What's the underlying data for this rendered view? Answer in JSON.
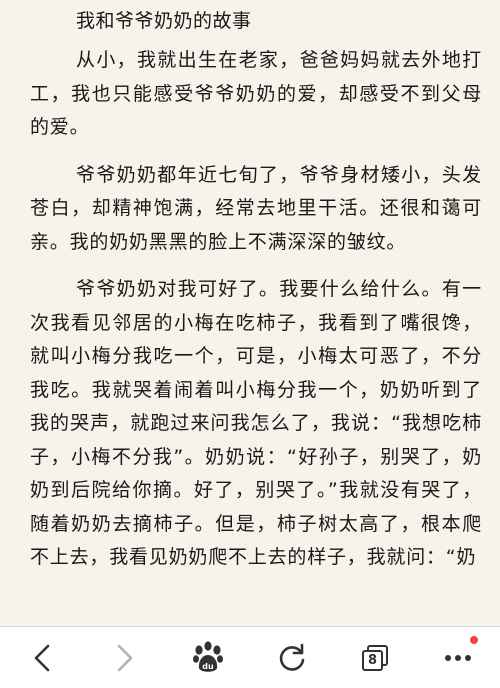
{
  "article": {
    "title": "我和爷爷奶奶的故事",
    "paragraphs": [
      "从小，我就出生在老家，爸爸妈妈就去外地打工，我也只能感受爷爷奶奶的爱，却感受不到父母的爱。",
      "爷爷奶奶都年近七旬了，爷爷身材矮小，头发苍白，却精神饱满，经常去地里干活。还很和蔼可亲。我的奶奶黑黑的脸上不满深深的皱纹。",
      "爷爷奶奶对我可好了。我要什么给什么。有一次我看见邻居的小梅在吃柿子，我看到了嘴很馋，就叫小梅分我吃一个，可是，小梅太可恶了，不分我吃。我就哭着闹着叫小梅分我一个，奶奶听到了我的哭声，就跑过来问我怎么了，我说：“我想吃柿子，小梅不分我”。奶奶说：“好孙子，别哭了，奶奶到后院给你摘。好了，别哭了。”我就没有哭了，随着奶奶去摘柿子。但是，柿子树太高了，根本爬不上去，我看见奶奶爬不上去的样子，我就问：“奶"
    ]
  },
  "toolbar": {
    "back_icon": "chevron-left-icon",
    "forward_icon": "chevron-right-icon",
    "home_icon": "baidu-paw-icon",
    "home_label": "du",
    "refresh_icon": "refresh-icon",
    "tabs_icon": "tabs-icon",
    "tab_count": "8",
    "menu_icon": "more-icon",
    "colors": {
      "icon": "#333333",
      "icon_disabled": "#b3b3b3",
      "notification": "#f0443c"
    }
  }
}
